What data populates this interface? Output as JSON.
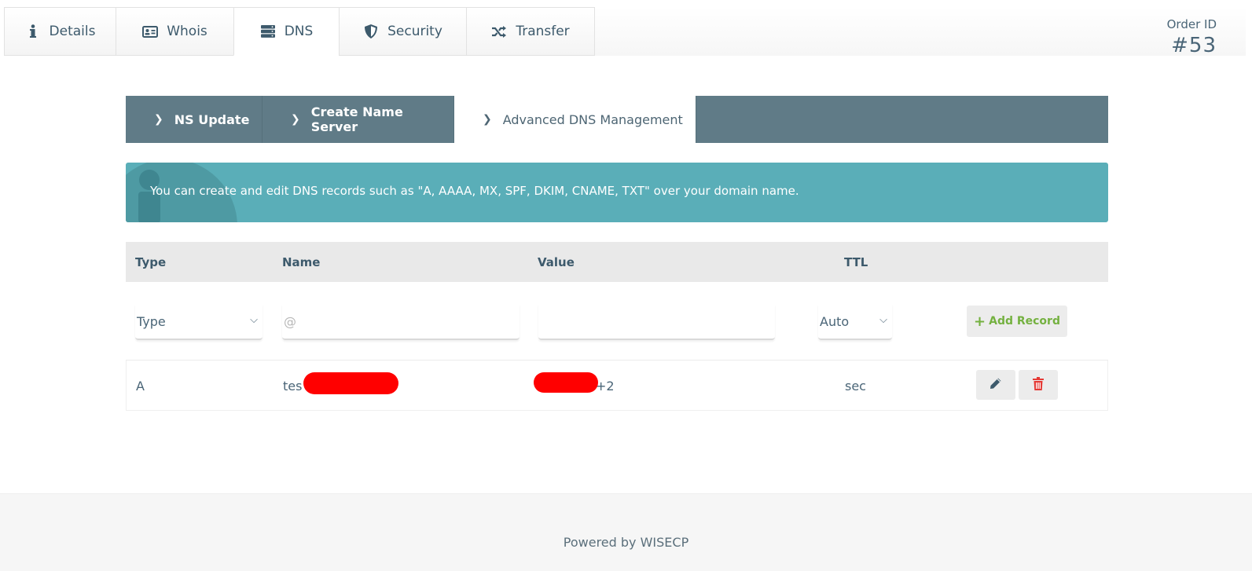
{
  "top_tabs": [
    {
      "label": "Details",
      "icon": "info-icon"
    },
    {
      "label": "Whois",
      "icon": "id-card-icon"
    },
    {
      "label": "DNS",
      "icon": "server-icon",
      "active": true
    },
    {
      "label": "Security",
      "icon": "shield-icon"
    },
    {
      "label": "Transfer",
      "icon": "shuffle-icon"
    }
  ],
  "order": {
    "label": "Order ID",
    "value": "#53"
  },
  "sub_tabs": [
    {
      "label": "NS Update"
    },
    {
      "label": "Create Name Server"
    },
    {
      "label": "Advanced DNS Management",
      "active": true
    }
  ],
  "info": {
    "text": "You can create and edit DNS records such as \"A, AAAA, MX, SPF, DKIM, CNAME, TXT\" over your domain name."
  },
  "table": {
    "headers": {
      "type": "Type",
      "name": "Name",
      "value": "Value",
      "ttl": "TTL"
    },
    "form": {
      "type_select": "Type",
      "name_placeholder": "@",
      "value_placeholder": "",
      "ttl_select": "Auto",
      "add_button": "Add Record"
    },
    "rows": [
      {
        "type": "A",
        "name_prefix": "tes",
        "value_suffix": "+2",
        "ttl": "sec"
      }
    ]
  },
  "footer": {
    "text": "Powered by WISECP"
  },
  "colors": {
    "tab_text": "#3d5a6c",
    "subnav_bg": "#607b87",
    "info_bg": "#5aaeb8",
    "add_green": "#74b140",
    "delete_red": "#e53935",
    "redaction": "#ff0000"
  }
}
